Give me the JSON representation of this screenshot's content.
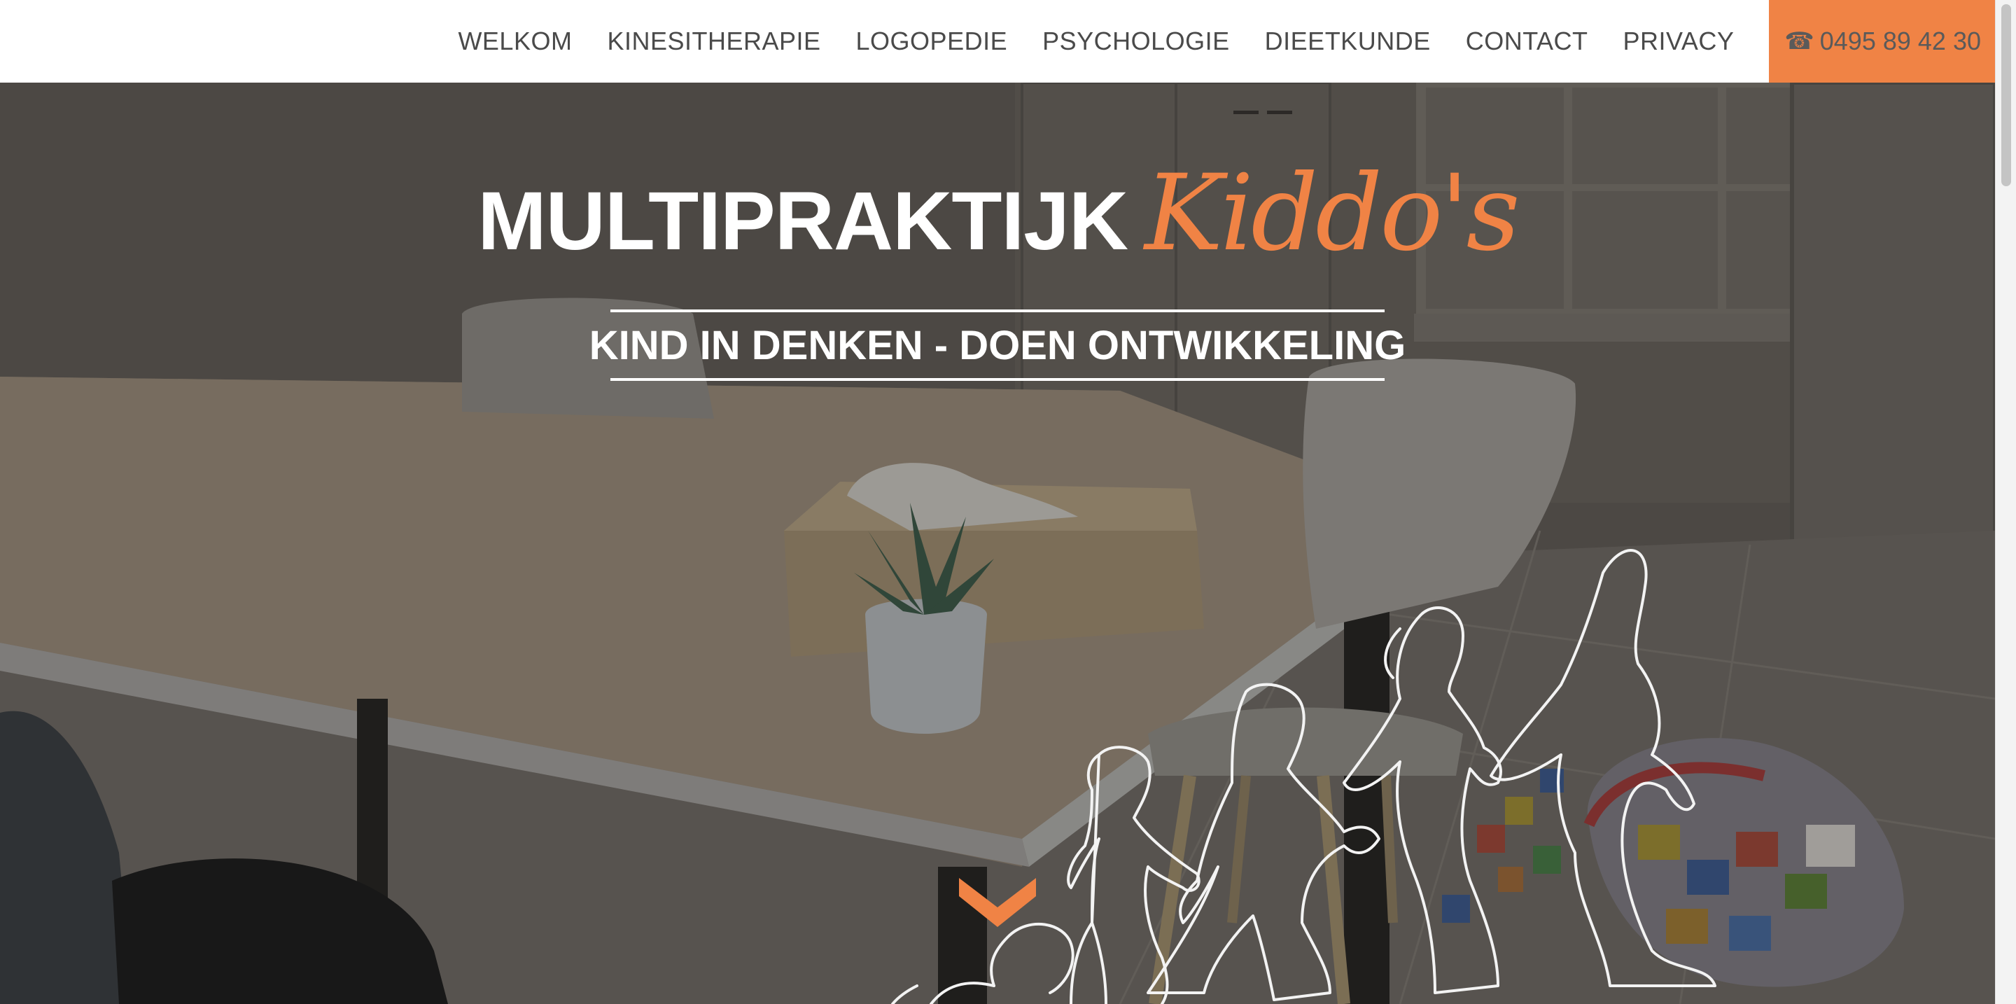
{
  "nav": {
    "items": [
      {
        "label": "WELKOM"
      },
      {
        "label": "KINESITHERAPIE"
      },
      {
        "label": "LOGOPEDIE"
      },
      {
        "label": "PSYCHOLOGIE"
      },
      {
        "label": "DIEETKUNDE"
      },
      {
        "label": "CONTACT"
      },
      {
        "label": "PRIVACY"
      }
    ],
    "phone": {
      "icon": "phone-icon",
      "glyph": "☎",
      "number": "0495 89 42 30"
    }
  },
  "hero": {
    "title_main": "MULTIPRAKTIJK",
    "title_brand": "Kiddo's",
    "subtitle": "KIND IN DENKEN - DOEN ONTWIKKELING",
    "scroll_icon": "chevron-down-icon"
  },
  "colors": {
    "accent": "#f08345",
    "nav_text": "#4a4a4a",
    "overlay": "#4d4946",
    "white": "#ffffff"
  }
}
